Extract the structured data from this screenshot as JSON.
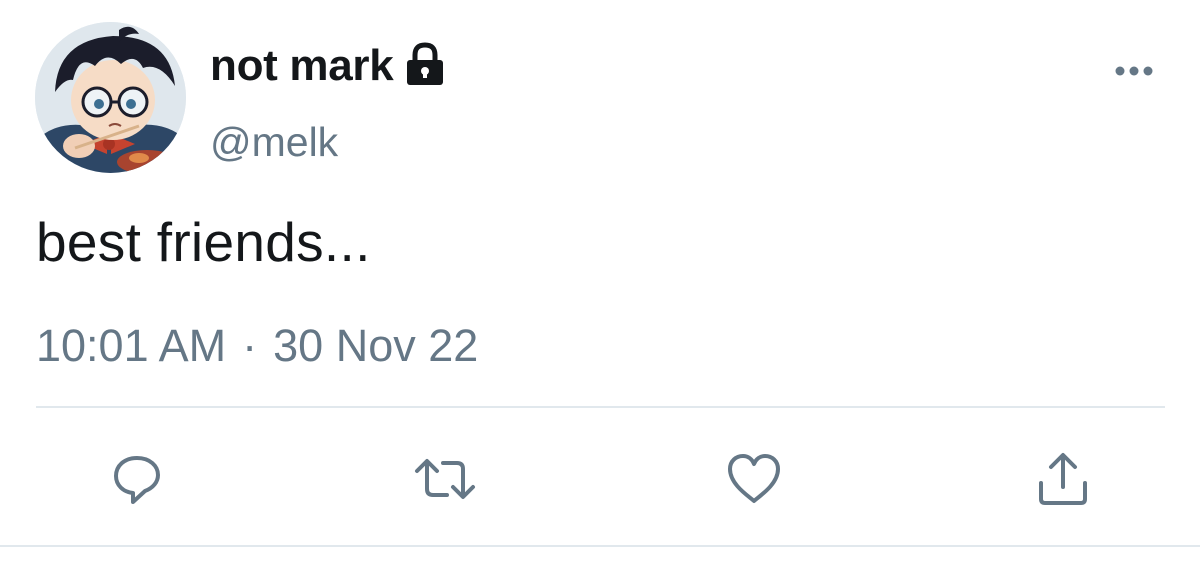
{
  "user": {
    "display_name": "not mark",
    "handle": "@melk",
    "protected": true,
    "avatar_icon": "anime-character-avatar"
  },
  "tweet": {
    "text": "best friends...",
    "time": "10:01 AM",
    "separator": "·",
    "date": "30 Nov 22"
  },
  "actions": {
    "reply_icon": "reply-icon",
    "retweet_icon": "retweet-icon",
    "like_icon": "heart-icon",
    "share_icon": "share-icon"
  },
  "colors": {
    "primary_text": "#14171a",
    "secondary_text": "#657786",
    "divider": "#e1e8ed",
    "icon": "#657786"
  }
}
